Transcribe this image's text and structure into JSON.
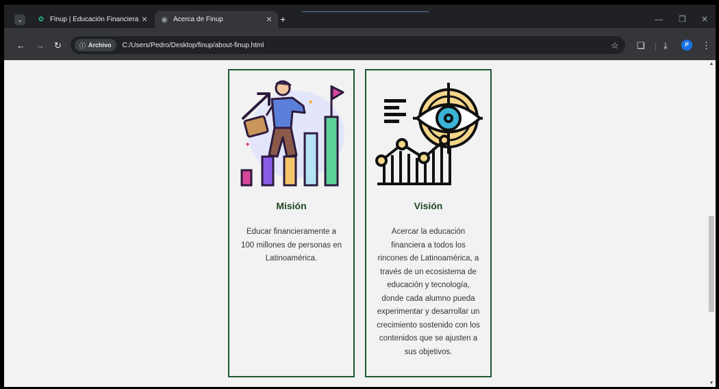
{
  "browser": {
    "tabs": [
      {
        "title": "Finup | Educación Financiera",
        "active": false,
        "favicon": "finup-leaf-icon"
      },
      {
        "title": "Acerca de Finup",
        "active": true,
        "favicon": "globe-icon"
      }
    ],
    "address": {
      "security_chip": "Archivo",
      "url": "C:/Users/Pedro/Desktop/finup/about-finup.html"
    },
    "profile_initial": "P"
  },
  "page": {
    "cards": [
      {
        "title": "Misión",
        "text": "Educar financieramente a 100 millones de personas en Latinoamérica.",
        "illustration": "climbing-bar-chart-illustration"
      },
      {
        "title": "Visión",
        "text": "Acercar la educación financiera a todos los rincones de Latinoamérica, a través de un ecosistema de educación y tecnología, donde cada alumno pueda experimentar y desarrollar un crecimiento sostenido con los contenidos que se ajusten a sus objetivos.",
        "illustration": "eye-target-growth-illustration"
      }
    ]
  },
  "colors": {
    "card_border": "#1e5631",
    "heading": "#1e4620",
    "page_bg": "#f2f2f2"
  }
}
